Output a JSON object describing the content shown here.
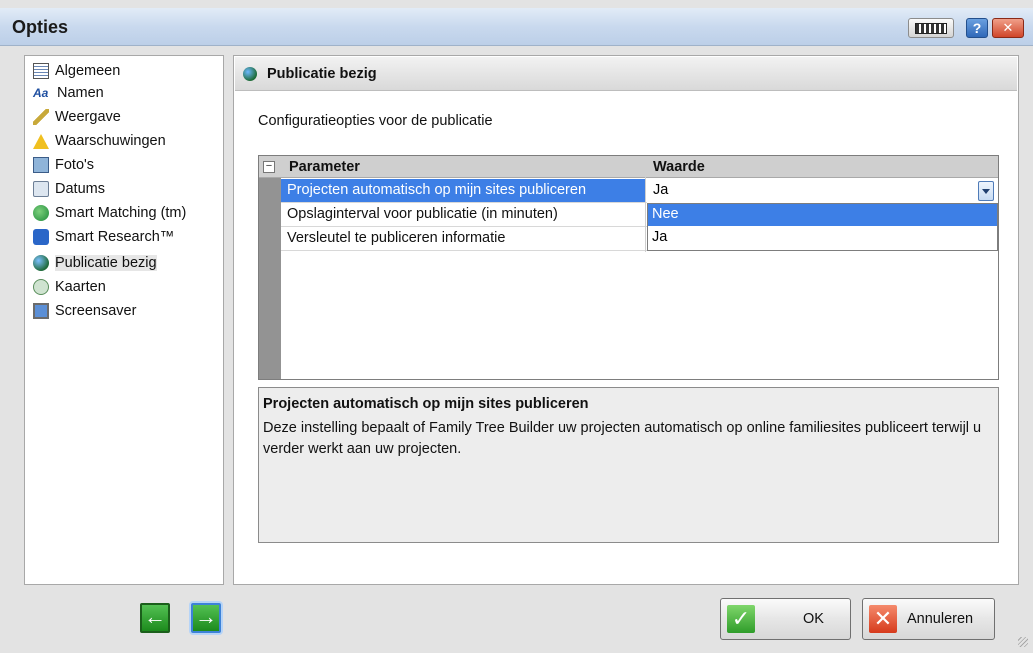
{
  "window": {
    "title": "Opties"
  },
  "sidebar": {
    "items": [
      {
        "label": "Algemeen",
        "icon": "document-icon"
      },
      {
        "label": "Namen",
        "icon": "font-icon"
      },
      {
        "label": "Weergave",
        "icon": "brush-icon"
      },
      {
        "label": "Waarschuwingen",
        "icon": "warning-icon"
      },
      {
        "label": "Foto's",
        "icon": "photo-icon"
      },
      {
        "label": "Datums",
        "icon": "calendar-icon"
      },
      {
        "label": "Smart Matching (tm)",
        "icon": "smart-matching-icon"
      },
      {
        "label": "Smart Research™",
        "icon": "smart-research-icon"
      },
      {
        "label": "Publicatie bezig",
        "icon": "globe-icon",
        "selected": true
      },
      {
        "label": "Kaarten",
        "icon": "map-icon"
      },
      {
        "label": "Screensaver",
        "icon": "monitor-icon"
      }
    ]
  },
  "section": {
    "title": "Publicatie bezig",
    "description": "Configuratieopties voor de publicatie"
  },
  "grid": {
    "collapse_symbol": "−",
    "header_param": "Parameter",
    "header_value": "Waarde",
    "rows": [
      {
        "param": "Projecten automatisch op mijn sites publiceren",
        "value": "Ja"
      },
      {
        "param": "Opslaginterval voor publicatie (in minuten)"
      },
      {
        "param": "Versleutel te publiceren informatie"
      }
    ],
    "dropdown_options": [
      "Nee",
      "Ja"
    ],
    "dropdown_highlighted": "Nee"
  },
  "info": {
    "title": "Projecten automatisch op mijn sites publiceren",
    "text": "Deze instelling bepaalt of Family Tree Builder uw projecten automatisch op online familiesites publiceert terwijl u verder werkt aan uw projecten."
  },
  "buttons": {
    "help": "?",
    "close": "✕",
    "back": "←",
    "forward": "→",
    "ok_check": "✓",
    "ok": "OK",
    "cancel_x": "✕",
    "cancel": "Annuleren"
  },
  "colors": {
    "selection": "#3d7fe6",
    "titlebar": "#c9d9ee",
    "nav_arrow": "#1c8a1c",
    "cancel_icon": "#d63a1c"
  }
}
